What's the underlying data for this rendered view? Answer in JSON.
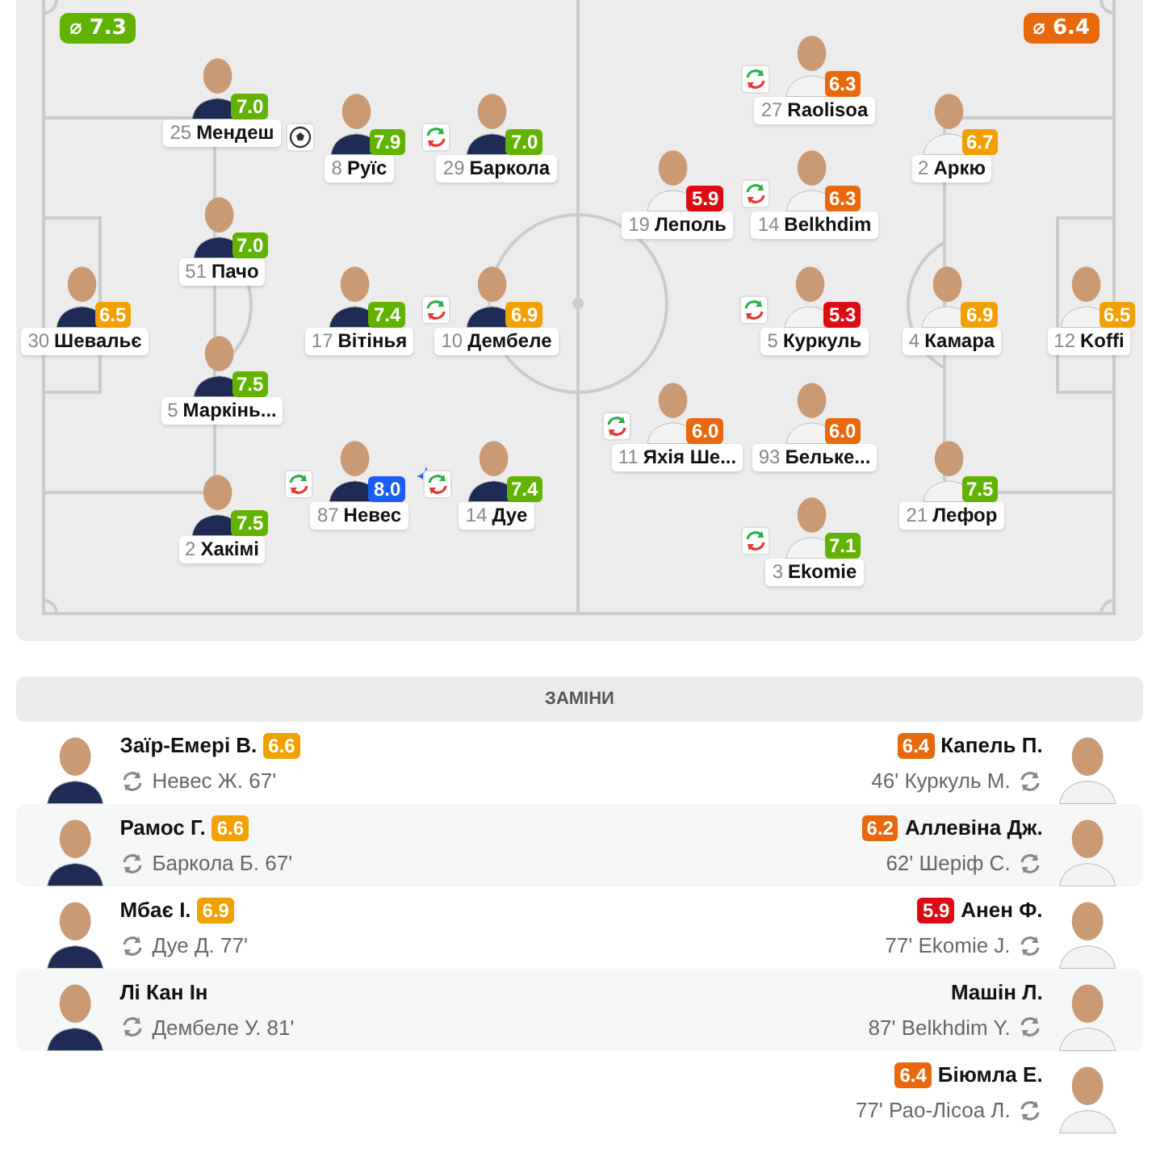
{
  "pitch": {
    "averages": [
      {
        "text": "⌀ 7.3",
        "color": "#62b300"
      },
      {
        "text": "⌀ 6.4",
        "color": "#e8680c"
      }
    ],
    "home": {
      "lines": [
        {
          "players": [
            {
              "number": "30",
              "name": "Шевальє",
              "rating": "6.5",
              "color": "#f29f00",
              "sub": false
            }
          ]
        },
        {
          "players": [
            {
              "number": "25",
              "name": "Мендеш",
              "rating": "7.0",
              "color": "#62b300",
              "sub": false
            },
            {
              "number": "51",
              "name": "Пачо",
              "rating": "7.0",
              "color": "#62b300",
              "sub": false
            },
            {
              "number": "5",
              "name": "Маркінь...",
              "rating": "7.5",
              "color": "#62b300",
              "sub": false
            },
            {
              "number": "2",
              "name": "Хакімі",
              "rating": "7.5",
              "color": "#62b300",
              "sub": false
            }
          ]
        },
        {
          "players": [
            {
              "number": "8",
              "name": "Руїс",
              "rating": "7.9",
              "color": "#62b300",
              "sub": false,
              "goal": true
            },
            {
              "number": "17",
              "name": "Вітінья",
              "rating": "7.4",
              "color": "#62b300",
              "sub": false
            },
            {
              "number": "87",
              "name": "Невес",
              "rating": "8.0",
              "color": "#1a5cf5",
              "sub": true,
              "top_rated": true
            }
          ]
        },
        {
          "players": [
            {
              "number": "29",
              "name": "Баркола",
              "rating": "7.0",
              "color": "#62b300",
              "sub": true
            },
            {
              "number": "10",
              "name": "Дембеле",
              "rating": "6.9",
              "color": "#f29f00",
              "sub": true
            },
            {
              "number": "14",
              "name": "Дуе",
              "rating": "7.4",
              "color": "#62b300",
              "sub": true
            }
          ]
        }
      ]
    },
    "away": {
      "lines": [
        {
          "players": [
            {
              "number": "19",
              "name": "Леполь",
              "rating": "5.9",
              "color": "#dc0d12",
              "sub": false
            },
            {
              "number": "11",
              "name": "Яхія Ше...",
              "rating": "6.0",
              "color": "#e8680c",
              "sub": true
            }
          ]
        },
        {
          "players": [
            {
              "number": "27",
              "name": "Raolisoa",
              "rating": "6.3",
              "color": "#e8680c",
              "sub": true
            },
            {
              "number": "14",
              "name": "Belkhdim",
              "rating": "6.3",
              "color": "#e8680c",
              "sub": true
            },
            {
              "number": "5",
              "name": "Куркуль",
              "rating": "5.3",
              "color": "#dc0d12",
              "sub": true
            },
            {
              "number": "93",
              "name": "Бельке...",
              "rating": "6.0",
              "color": "#e8680c",
              "sub": false
            },
            {
              "number": "3",
              "name": "Ekomie",
              "rating": "7.1",
              "color": "#62b300",
              "sub": true
            }
          ]
        },
        {
          "players": [
            {
              "number": "2",
              "name": "Аркю",
              "rating": "6.7",
              "color": "#f29f00",
              "sub": false
            },
            {
              "number": "4",
              "name": "Камара",
              "rating": "6.9",
              "color": "#f29f00",
              "sub": false
            },
            {
              "number": "21",
              "name": "Лефор",
              "rating": "7.5",
              "color": "#62b300",
              "sub": false
            }
          ]
        },
        {
          "players": [
            {
              "number": "12",
              "name": "Koffi",
              "rating": "6.5",
              "color": "#f29f00",
              "sub": false
            }
          ]
        }
      ]
    }
  },
  "substitutions": {
    "title": "ЗАМІНИ",
    "rows": [
      {
        "home": {
          "name": "Заїр-Емері В.",
          "rating": "6.6",
          "color": "#f29f00",
          "replaced": "Невес Ж. 67'"
        },
        "away": {
          "name": "Капель П.",
          "rating": "6.4",
          "color": "#e8680c",
          "replaced": "46' Куркуль М."
        }
      },
      {
        "home": {
          "name": "Рамос Г.",
          "rating": "6.6",
          "color": "#f29f00",
          "replaced": "Баркола Б. 67'"
        },
        "away": {
          "name": "Аллевіна Дж.",
          "rating": "6.2",
          "color": "#e8680c",
          "replaced": "62' Шеріф С."
        }
      },
      {
        "home": {
          "name": "Мбає І.",
          "rating": "6.9",
          "color": "#f29f00",
          "replaced": "Дуе Д. 77'"
        },
        "away": {
          "name": "Анен Ф.",
          "rating": "5.9",
          "color": "#dc0d12",
          "replaced": "77' Ekomie J."
        }
      },
      {
        "home": {
          "name": "Лі Кан Ін",
          "replaced": "Дембеле У. 81'"
        },
        "away": {
          "name": "Машін Л.",
          "replaced": "87' Belkhdim Y."
        }
      },
      {
        "away": {
          "name": "Біюмла Е.",
          "rating": "6.4",
          "color": "#e8680c",
          "replaced": "77' Рао-Лісоа Л."
        }
      }
    ]
  }
}
